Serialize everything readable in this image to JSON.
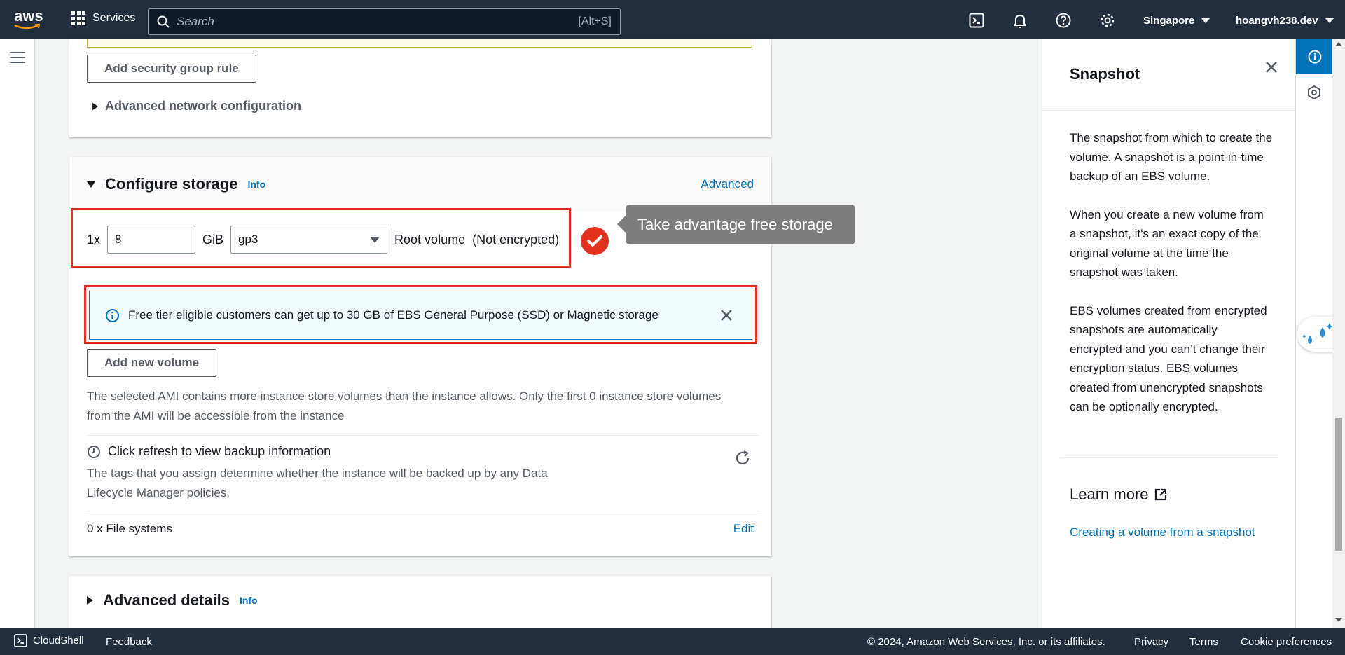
{
  "topnav": {
    "logo_text": "aws",
    "services_label": "Services",
    "search_placeholder": "Search",
    "search_shortcut": "[Alt+S]",
    "region": "Singapore",
    "account": "hoangvh238.dev"
  },
  "network": {
    "add_sg_rule_label": "Add security group rule",
    "advanced_network_label": "Advanced network configuration"
  },
  "storage": {
    "title": "Configure storage",
    "info_label": "Info",
    "advanced_label": "Advanced",
    "count_label": "1x",
    "size_value": "8",
    "unit_label": "GiB",
    "volume_type": "gp3",
    "root_label": "Root volume",
    "encryption_label": "(Not encrypted)",
    "tooltip": "Take advantage free storage",
    "free_tier_alert": "Free tier eligible customers can get up to 30 GB of EBS General Purpose (SSD) or Magnetic storage",
    "add_volume_label": "Add new volume",
    "ami_note_line1": "The selected AMI contains more instance store volumes than the instance allows. Only the first 0 instance store volumes",
    "ami_note_line2": "from the AMI will be accessible from the instance",
    "backup_title": "Click refresh to view backup information",
    "backup_desc_line1": "The tags that you assign determine whether the instance will be backed up by any Data",
    "backup_desc_line2": "Lifecycle Manager policies.",
    "file_systems_label": "0 x File systems",
    "edit_label": "Edit"
  },
  "advanced_details": {
    "title": "Advanced details",
    "info_label": "Info"
  },
  "help_panel": {
    "title": "Snapshot",
    "paragraphs": [
      "The snapshot from which to create the volume. A snapshot is a point-in-time backup of an EBS volume.",
      "When you create a new volume from a snapshot, it's an exact copy of the original volume at the time the snapshot was taken.",
      "EBS volumes created from encrypted snapshots are automatically encrypted and you can’t change their encryption status. EBS volumes created from unencrypted snapshots can be optionally encrypted."
    ],
    "learn_more": "Learn more",
    "link_label": "Creating a volume from a snapshot"
  },
  "footer": {
    "cloudshell_label": "CloudShell",
    "feedback_label": "Feedback",
    "copyright": "© 2024, Amazon Web Services, Inc. or its affiliates.",
    "privacy_label": "Privacy",
    "terms_label": "Terms",
    "cookie_label": "Cookie preferences"
  },
  "colors": {
    "nav_bg": "#232f3e",
    "link": "#0073bb",
    "highlight_red": "#e3311f",
    "alert_bg": "#f1faff"
  }
}
